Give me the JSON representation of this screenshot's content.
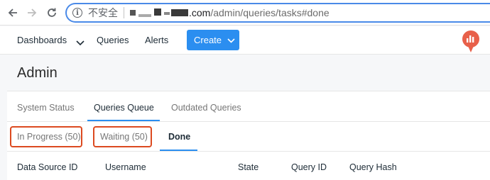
{
  "browser": {
    "insecure_label": "不安全",
    "url_domain": ".com",
    "url_path": "/admin/queries/tasks#done"
  },
  "header": {
    "nav": [
      "Dashboards",
      "Queries",
      "Alerts"
    ],
    "create_label": "Create"
  },
  "page": {
    "title": "Admin"
  },
  "tabs": [
    "System Status",
    "Queries Queue",
    "Outdated Queries"
  ],
  "active_tab": "Queries Queue",
  "subtabs": [
    "In Progress (50)",
    "Waiting (50)",
    "Done"
  ],
  "active_subtab": "Done",
  "table": {
    "columns": [
      "Data Source ID",
      "Username",
      "State",
      "Query ID",
      "Query Hash"
    ]
  },
  "colors": {
    "accent": "#2b8ef0",
    "highlight": "#dc4a20",
    "logo": "#e8604a"
  }
}
